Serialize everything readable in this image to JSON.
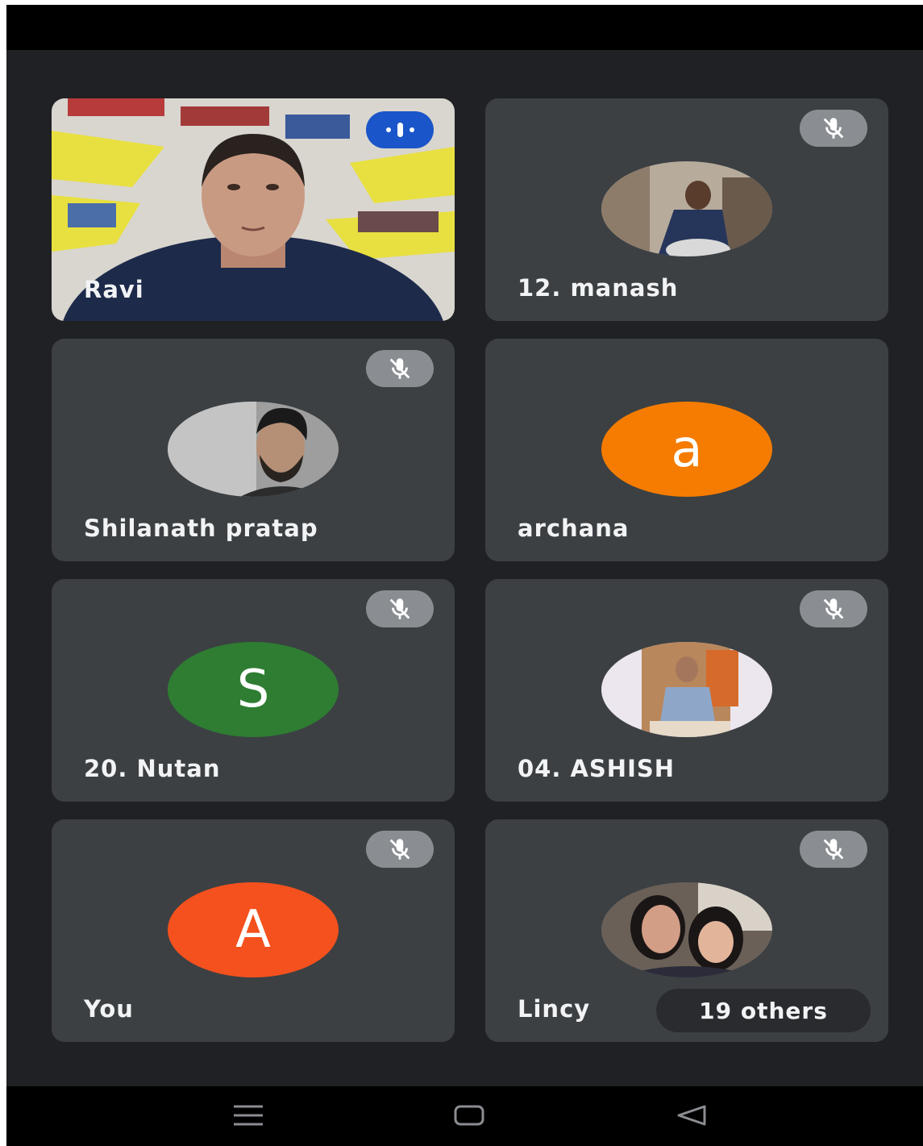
{
  "participants": [
    {
      "name": "Ravi"
    },
    {
      "name": "12. manash"
    },
    {
      "name": "Shilanath pratap"
    },
    {
      "name": "archana",
      "initial": "a"
    },
    {
      "name": "20. Nutan",
      "initial": "S"
    },
    {
      "name": "04. ASHISH"
    },
    {
      "name": "You",
      "initial": "A"
    },
    {
      "name": "Lincy"
    }
  ],
  "others_label": "19 others",
  "colors": {
    "tile": "#3c4043",
    "background": "#202124",
    "speaking_indicator": "#1a56c9",
    "avatar_archana": "#f57c00",
    "avatar_nutan": "#2e7d32",
    "avatar_you": "#f4511e"
  },
  "icons": {
    "muted": "mic-off-icon",
    "speaking": "audio-level-icon",
    "nav_menu": "menu-icon",
    "nav_home": "home-icon",
    "nav_back": "back-icon"
  }
}
